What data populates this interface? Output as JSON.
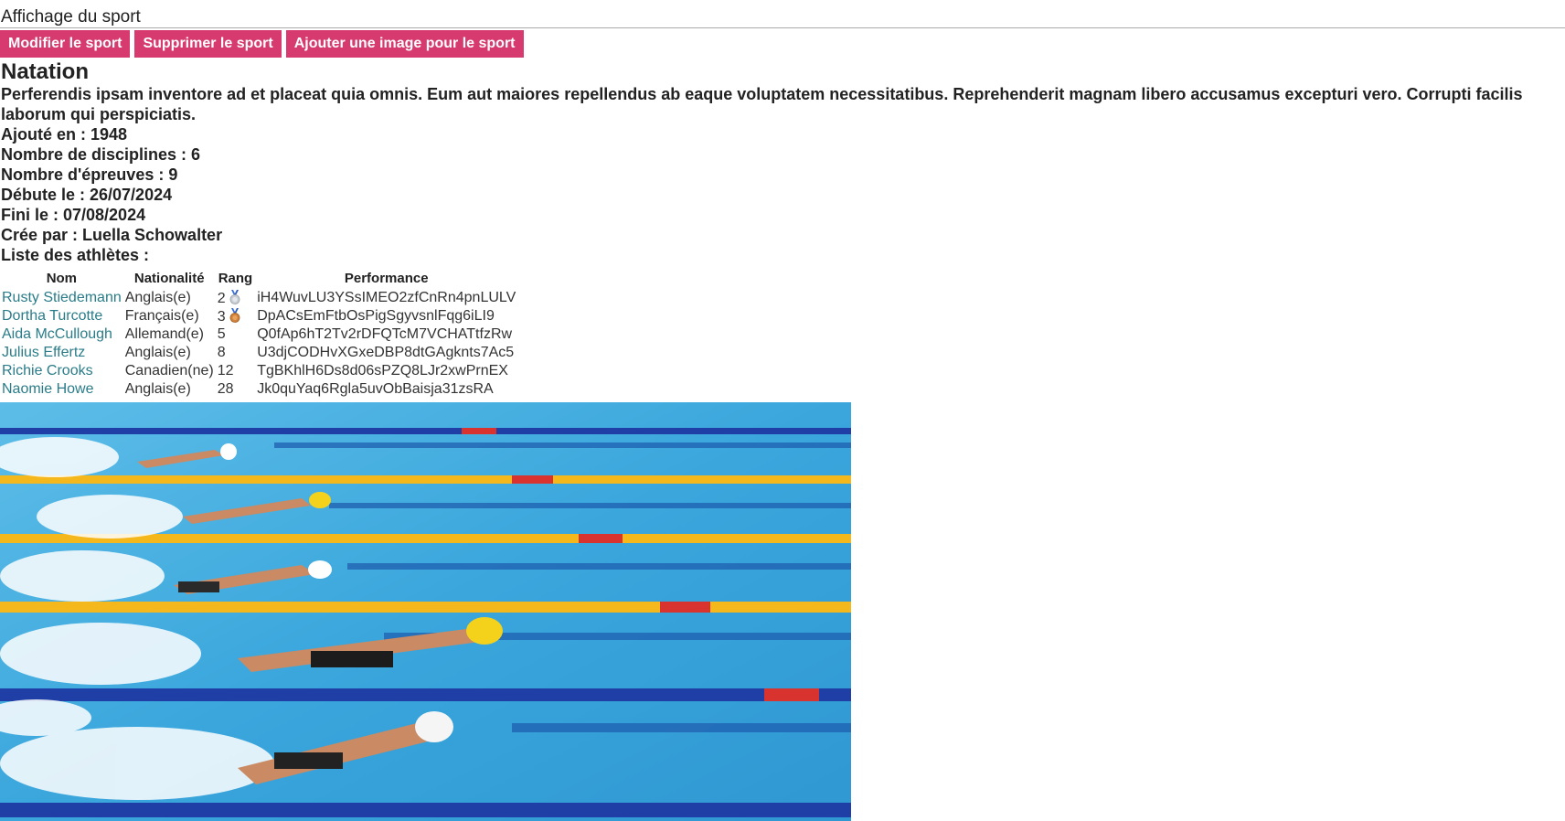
{
  "header": {
    "title": "Affichage du sport"
  },
  "toolbar": {
    "edit_label": "Modifier le sport",
    "delete_label": "Supprimer le sport",
    "add_image_label": "Ajouter une image pour le sport"
  },
  "sport": {
    "name": "Natation",
    "description": "Perferendis ipsam inventore ad et placeat quia omnis. Eum aut maiores repellendus ab eaque voluptatem necessitatibus. Reprehenderit magnam libero accusamus excepturi vero. Corrupti facilis laborum qui perspiciatis.",
    "added_in": "Ajouté en : 1948",
    "disciplines": "Nombre de disciplines : 6",
    "events": "Nombre d'épreuves : 9",
    "start_date": "Débute le : 26/07/2024",
    "end_date": "Fini le : 07/08/2024",
    "created_by": "Crée par : Luella Schowalter",
    "athletes_heading": "Liste des athlètes :"
  },
  "athletes_table": {
    "columns": [
      "Nom",
      "Nationalité",
      "Rang",
      "Performance"
    ],
    "rows": [
      {
        "name": "Rusty Stiedemann",
        "nationality": "Anglais(e)",
        "rank": "2",
        "medal": "silver-medal",
        "performance": "iH4WuvLU3YSsIMEO2zfCnRn4pnLULV"
      },
      {
        "name": "Dortha Turcotte",
        "nationality": "Français(e)",
        "rank": "3",
        "medal": "bronze-medal",
        "performance": "DpACsEmFtbOsPigSgyvsnlFqg6iLI9"
      },
      {
        "name": "Aida McCullough",
        "nationality": "Allemand(e)",
        "rank": "5",
        "medal": "",
        "performance": "Q0fAp6hT2Tv2rDFQTcM7VCHATtfzRw"
      },
      {
        "name": "Julius Effertz",
        "nationality": "Anglais(e)",
        "rank": "8",
        "medal": "",
        "performance": "U3djCODHvXGxeDBP8dtGAgknts7Ac5"
      },
      {
        "name": "Richie Crooks",
        "nationality": "Canadien(ne)",
        "rank": "12",
        "medal": "",
        "performance": "TgBKhlH6Ds8d06sPZQ8LJr2xwPrnEX"
      },
      {
        "name": "Naomie Howe",
        "nationality": "Anglais(e)",
        "rank": "28",
        "medal": "",
        "performance": "Jk0quYaq6Rgla5uvObBaisja31zsRA"
      }
    ]
  },
  "image": {
    "subject": "swimming-race-photo"
  },
  "colors": {
    "accent": "#d63a6e",
    "link": "#2a7c89",
    "pool": "#3fa9dd"
  }
}
